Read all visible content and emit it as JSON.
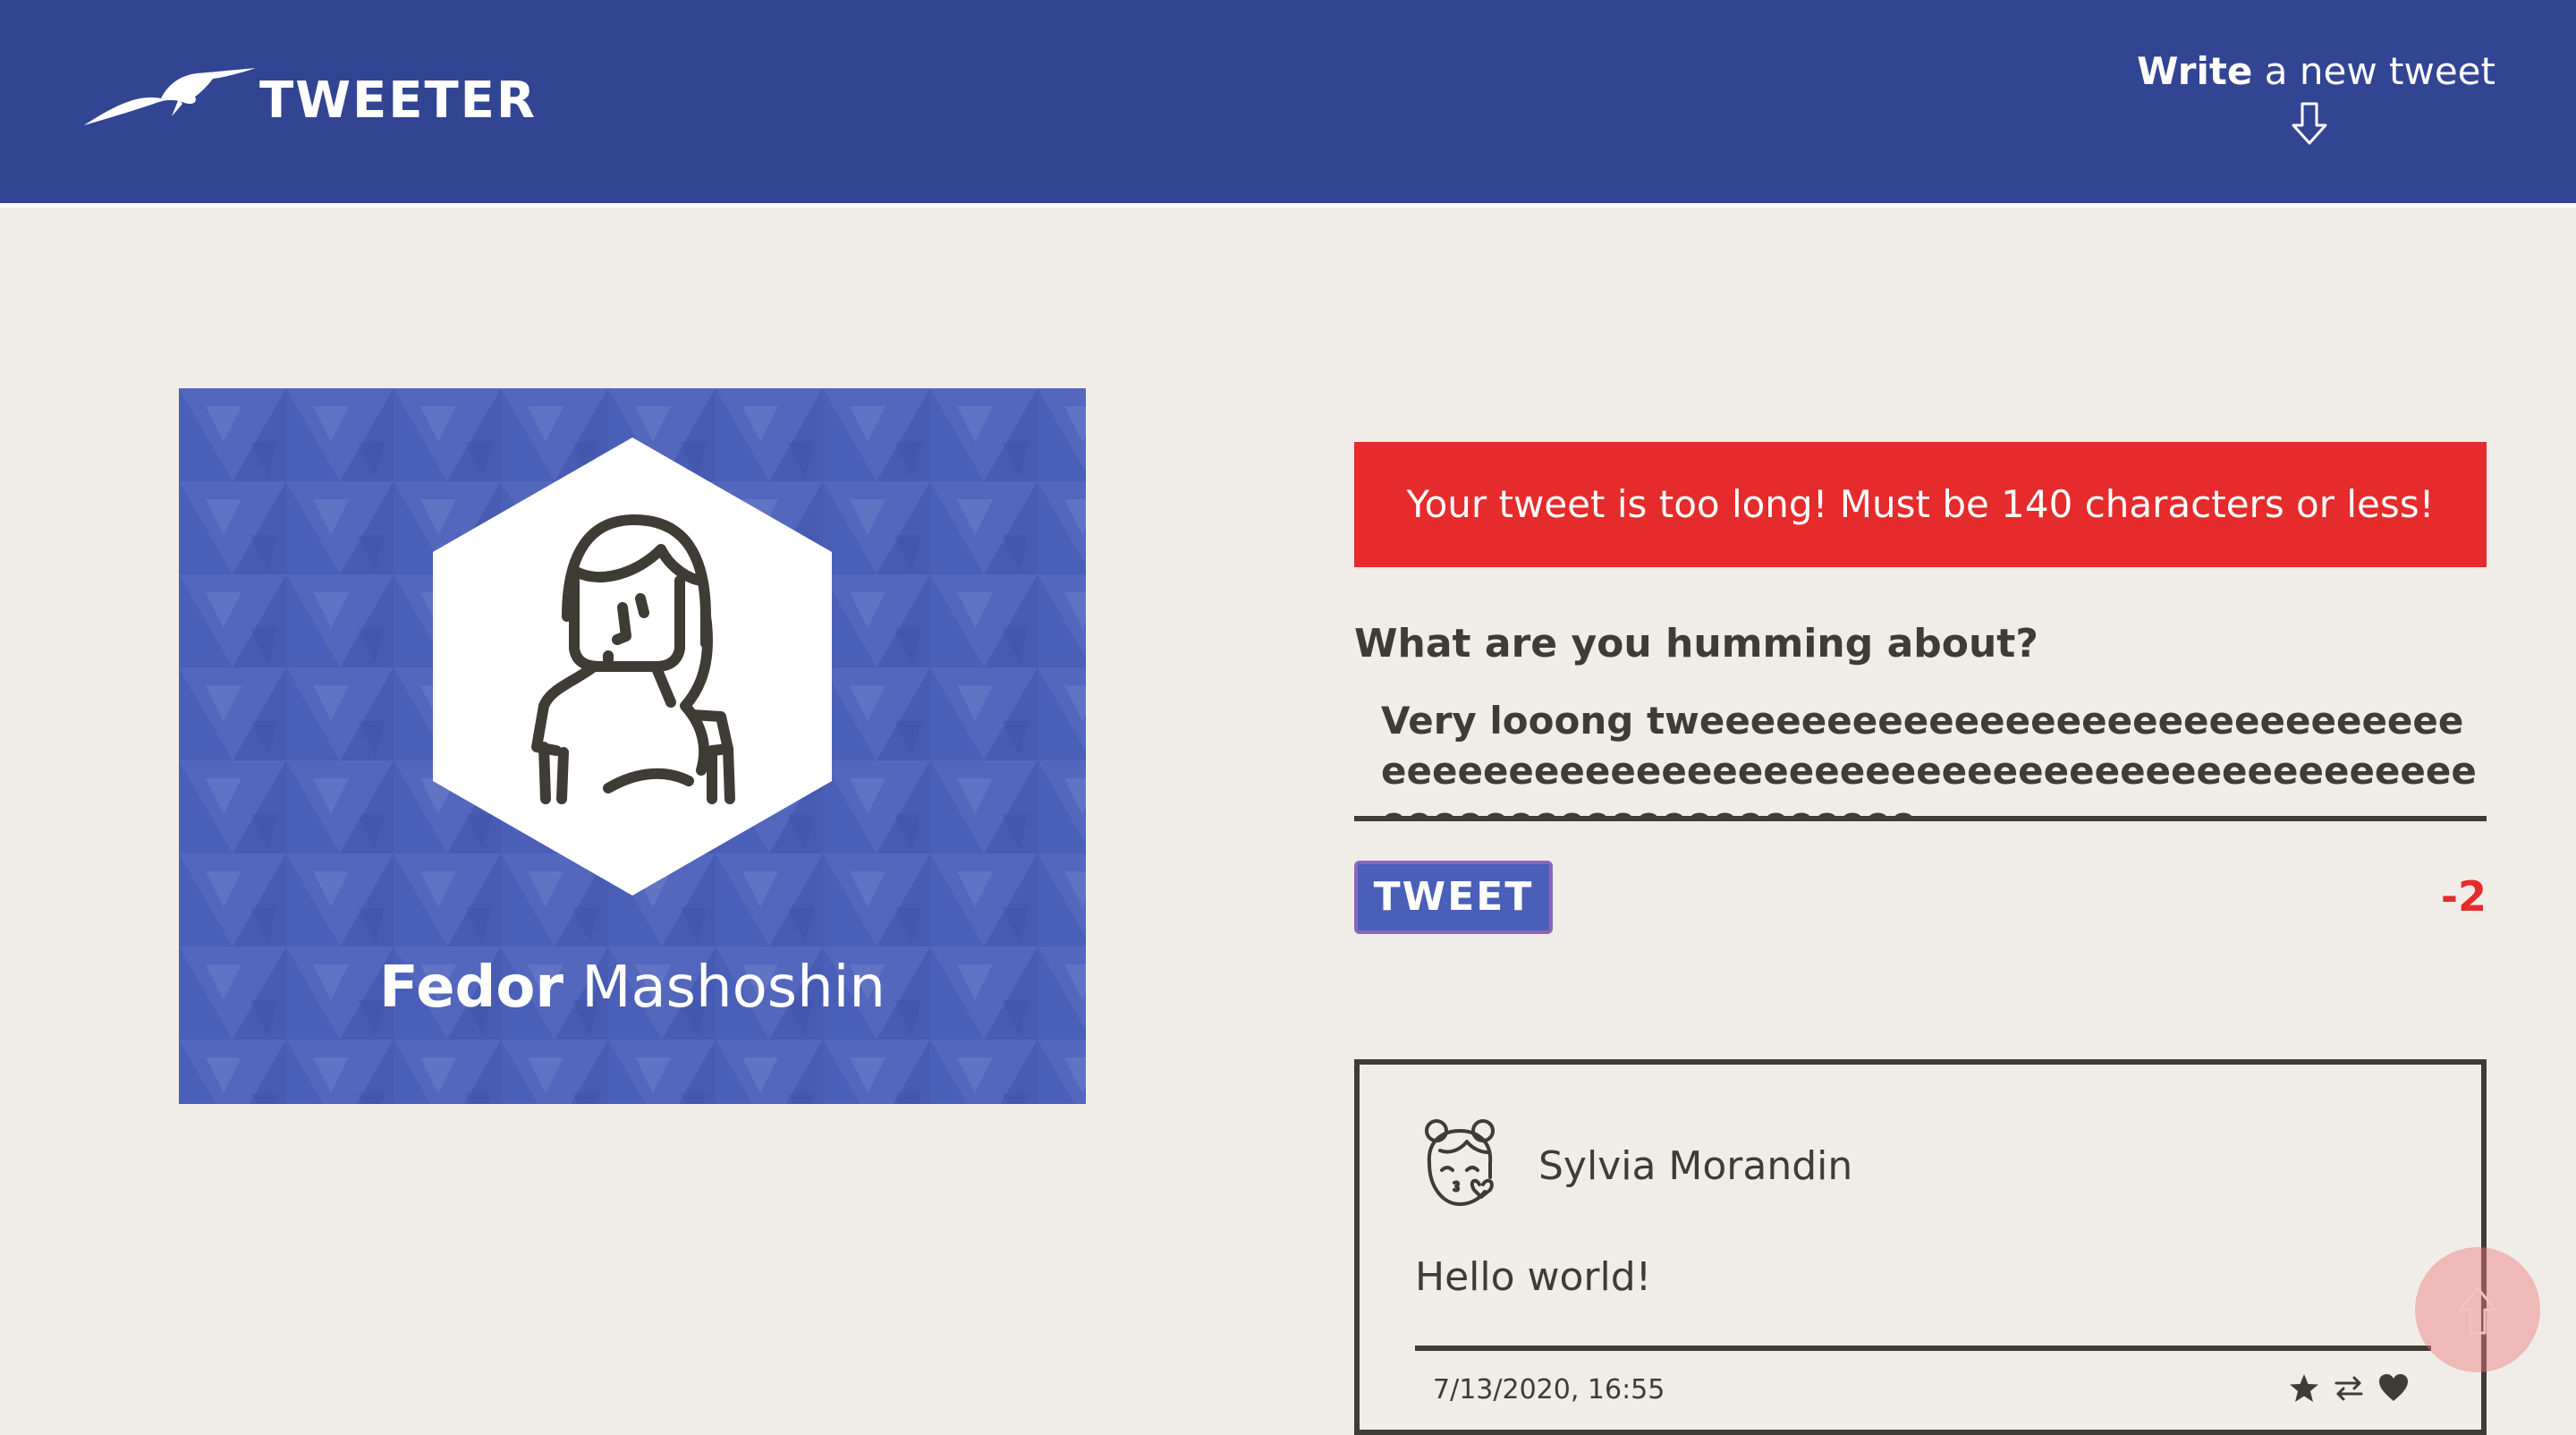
{
  "nav": {
    "brand": "TWEETER",
    "compose_bold": "Write",
    "compose_rest": " a new tweet"
  },
  "profile": {
    "first_name": "Fedor",
    "last_name": "Mashoshin"
  },
  "compose": {
    "error": "Your tweet is too long! Must be 140 characters or less!",
    "label": "What are you humming about?",
    "text": "Very looong tweeeeeeeeeeeeeeeeeeeeeeeeeeeeeeeeeeeeeeeeeeeeeeeeeeeeeeeeeeeeeeeeeeeeeeeeeeeeeeeeeeeeeeeeeeeeee",
    "button": "TWEET",
    "counter": "-2"
  },
  "tweets": [
    {
      "author": "Sylvia Morandin",
      "content": "Hello world!",
      "date": "7/13/2020, 16:55"
    }
  ],
  "colors": {
    "nav": "#324593",
    "background": "#f0ede8",
    "text": "#3f3b35",
    "error": "#e52b2b",
    "accent": "#4a5fb8"
  },
  "icons": [
    "bird-logo-icon",
    "arrow-down-icon",
    "star-icon",
    "retweet-icon",
    "heart-icon",
    "arrow-up-icon"
  ]
}
